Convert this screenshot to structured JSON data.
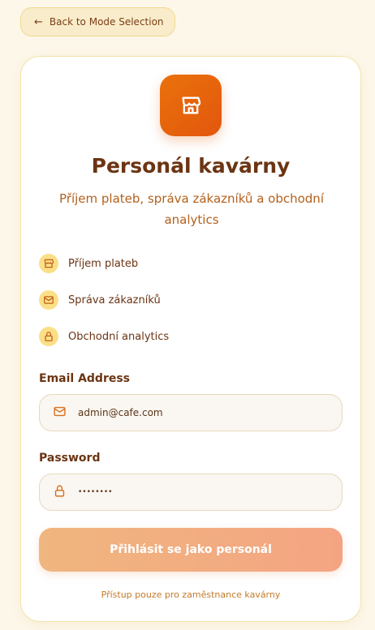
{
  "back_button": {
    "label": "Back to Mode Selection",
    "icon": "arrow-left-icon"
  },
  "header": {
    "logo_icon": "storefront-icon",
    "title": "Personál kavárny",
    "subtitle": "Příjem plateb, správa zákazníků a obchodní analytics"
  },
  "features": [
    {
      "label": "Příjem plateb",
      "icon": "store-icon"
    },
    {
      "label": "Správa zákazníků",
      "icon": "mail-icon"
    },
    {
      "label": "Obchodní analytics",
      "icon": "lock-icon"
    }
  ],
  "form": {
    "email_label": "Email Address",
    "email_value": "admin@cafe.com",
    "password_label": "Password",
    "password_value": "••••••••",
    "submit_label": "Přihlásit se jako personál"
  },
  "footer_note": "Přístup pouze pro zaměstnance kavárny",
  "colors": {
    "accent": "#e9650d",
    "text_dark": "#6b3413",
    "text_orange": "#b2611d",
    "background": "#fdf7ea"
  }
}
